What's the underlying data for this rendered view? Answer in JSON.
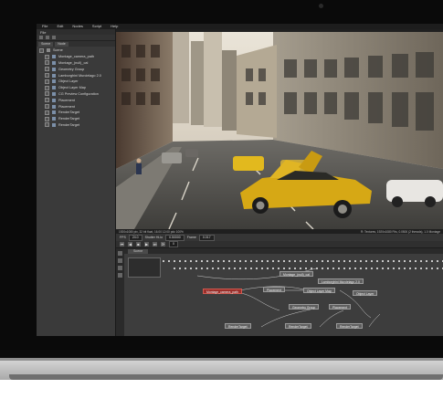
{
  "menu": [
    "File",
    "Edit",
    "Nodes",
    "Script",
    "Help"
  ],
  "panel": {
    "title": "File",
    "tabs": [
      "Scene",
      "Node"
    ],
    "tree": [
      {
        "label": "Scene",
        "root": true
      },
      {
        "label": "Montage_camera_path"
      },
      {
        "label": "Montage_(null)_cal"
      },
      {
        "label": "Geometry Group"
      },
      {
        "label": "Lamborghini Murcielago 2.0"
      },
      {
        "label": "Object Layer"
      },
      {
        "label": "Object Layer Map"
      },
      {
        "label": "CG Preview Configuration"
      },
      {
        "label": "Placement"
      },
      {
        "label": "Placement"
      },
      {
        "label": "RenderTarget"
      },
      {
        "label": "RenderTarget"
      },
      {
        "label": "RenderTarget"
      }
    ]
  },
  "viewer_status": {
    "left": "1920x1080 pix, 32 bit float, 16.00 12:00 pdc 100%",
    "right": "R: Textures, 1920x1080 Fits, 0.0500 (2 threads), 1.0 Montage"
  },
  "controls": {
    "fps_label": "FPS",
    "fps_value": "24.0",
    "shutter_label": "Shutter Hi-lo",
    "shutter_value": "0.50000",
    "frame_label": "Frame",
    "frame_value": "0.017"
  },
  "transport": {
    "frame_value": "0",
    "buttons": [
      "⏮",
      "◀",
      "■",
      "▶",
      "⏭",
      "⟳"
    ]
  },
  "graph": {
    "tab": "Scene",
    "nodes": [
      {
        "label": "Montage_(null)_cal",
        "red": false
      },
      {
        "label": "Lamborghini Murcielago 2.0",
        "red": false
      },
      {
        "label": "Montage_camera_path",
        "red": true
      },
      {
        "label": "Placement",
        "red": false
      },
      {
        "label": "Object Layer Map",
        "red": false
      },
      {
        "label": "Object Layer",
        "red": false
      },
      {
        "label": "Geometry Group",
        "red": false
      },
      {
        "label": "Placement",
        "red": false
      },
      {
        "label": "RenderTarget",
        "red": false
      },
      {
        "label": "RenderTarget",
        "red": false
      },
      {
        "label": "RenderTarget",
        "red": false
      }
    ]
  },
  "colors": {
    "node_red": "#9b2f2b",
    "car": "#d6a815",
    "bg": "#2c2c2c"
  }
}
